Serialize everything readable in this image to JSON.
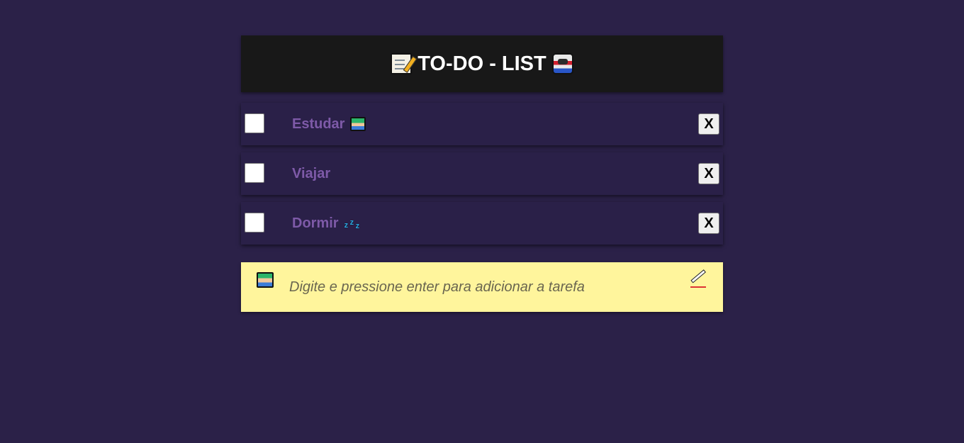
{
  "header": {
    "title": "TO-DO - LIST",
    "left_icon": "memo-icon",
    "right_icon": "flag-icon"
  },
  "tasks": [
    {
      "label": "Estudar",
      "icon": "study-icon",
      "delete_label": "X"
    },
    {
      "label": "Viajar",
      "icon": "",
      "delete_label": "X"
    },
    {
      "label": "Dormir",
      "icon": "sleep-icon",
      "delete_label": "X"
    }
  ],
  "input": {
    "placeholder": "Digite e pressione enter para adicionar a tarefa",
    "value": "",
    "left_icon": "study-icon",
    "right_icon": "pencil-icon"
  },
  "colors": {
    "background": "#2b2148",
    "header_bg": "#181818",
    "task_bg": "#2a2048",
    "task_text": "#7e5aa8",
    "input_bg": "#fff59c"
  }
}
